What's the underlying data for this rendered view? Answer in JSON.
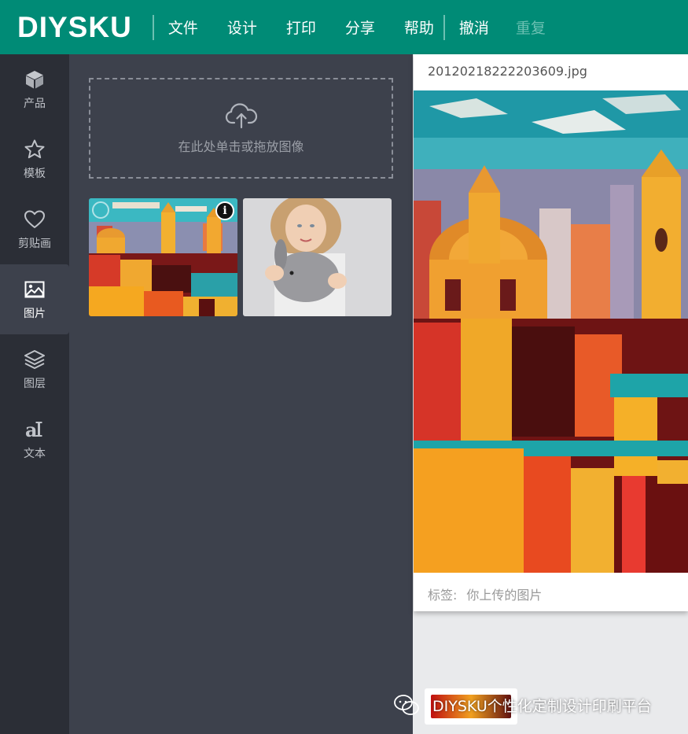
{
  "header": {
    "logo": "DIYSKU",
    "menu": [
      "文件",
      "设计",
      "打印",
      "分享",
      "帮助"
    ],
    "undo": "撤消",
    "redo": "重复"
  },
  "sidebar": {
    "items": [
      {
        "label": "产品",
        "icon": "cube-icon"
      },
      {
        "label": "模板",
        "icon": "star-icon"
      },
      {
        "label": "剪贴画",
        "icon": "heart-icon"
      },
      {
        "label": "图片",
        "icon": "image-icon",
        "active": true
      },
      {
        "label": "图层",
        "icon": "layers-icon"
      },
      {
        "label": "文本",
        "icon": "text-icon"
      }
    ]
  },
  "upload": {
    "text": "在此处单击或拖放图像"
  },
  "preview": {
    "filename": "20120218222203609.jpg",
    "tag_label": "标签:",
    "tag_value": "你上传的图片"
  },
  "watermark": {
    "text": "DIYSKU个性化定制设计印刷平台"
  },
  "colors": {
    "header": "#008b76",
    "sidebar": "#2b2e36",
    "panel": "#3d414c"
  }
}
